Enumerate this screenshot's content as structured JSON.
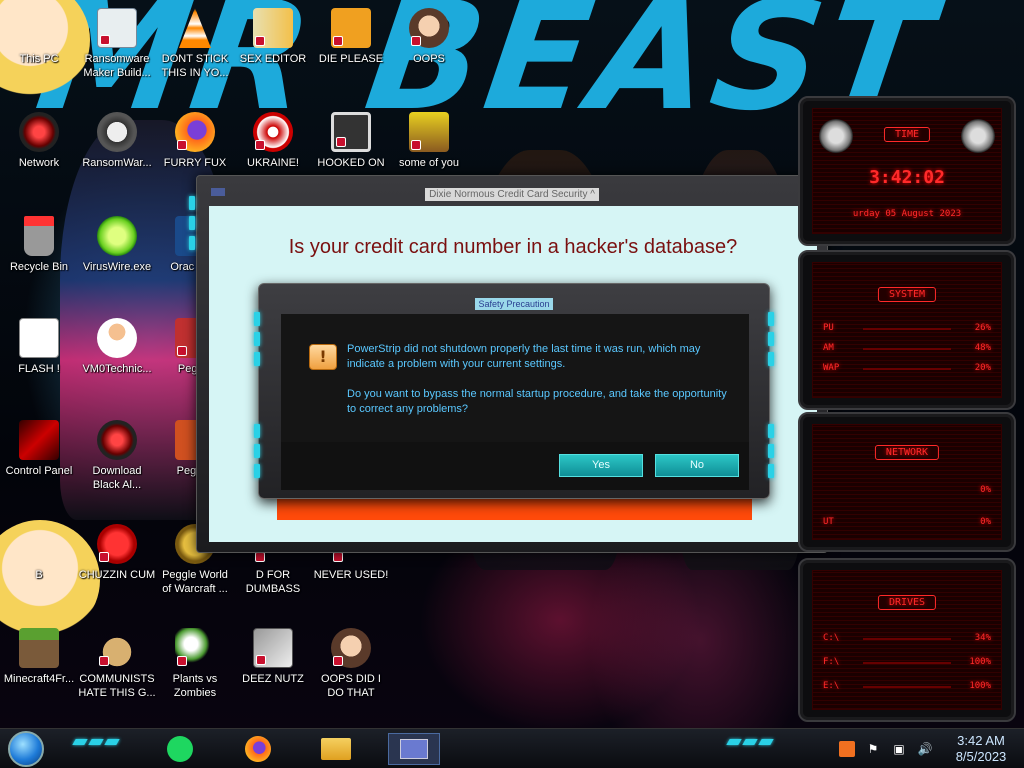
{
  "wallpaper": {
    "text": "MR BEAST"
  },
  "desktop_icons": [
    {
      "label": "This PC"
    },
    {
      "label": "Ransomware Maker Build..."
    },
    {
      "label": "DONT STICK THIS IN YO..."
    },
    {
      "label": "SEX EDITOR"
    },
    {
      "label": "DIE PLEASE"
    },
    {
      "label": "OOPS"
    },
    {
      "label": "Network"
    },
    {
      "label": "RansomWar..."
    },
    {
      "label": "FURRY FUX"
    },
    {
      "label": "UKRAINE!"
    },
    {
      "label": "HOOKED ON"
    },
    {
      "label": "some of you"
    },
    {
      "label": "Recycle Bin"
    },
    {
      "label": "VirusWire.exe"
    },
    {
      "label": "Orac Virtu"
    },
    {
      "label": "FLASH !"
    },
    {
      "label": "VM0Technic..."
    },
    {
      "label": "Peggle"
    },
    {
      "label": "Control Panel"
    },
    {
      "label": "Download Black Al..."
    },
    {
      "label": "Pegg D"
    },
    {
      "label": "B"
    },
    {
      "label": "CHUZZIN CUM"
    },
    {
      "label": "Peggle World of Warcraft ..."
    },
    {
      "label": "D FOR DUMBASS"
    },
    {
      "label": "NEVER USED!"
    },
    {
      "label": "Minecraft4Fr..."
    },
    {
      "label": "COMMUNISTS HATE THIS G..."
    },
    {
      "label": "Plants vs Zombies"
    },
    {
      "label": "DEEZ NUTZ"
    },
    {
      "label": "OOPS DID I DO THAT"
    }
  ],
  "main_window": {
    "title": "Dixie Normous Credit Card Security ^",
    "headline": "Is your credit card number in a hacker's database?"
  },
  "inner_dialog": {
    "title": "Safety Precaution",
    "message1": "PowerStrip did not shutdown properly the last time it was run, which may indicate a problem with your current settings.",
    "message2": "Do you want to bypass the normal startup procedure, and take the opportunity to correct any problems?",
    "yes_label": "Yes",
    "no_label": "No"
  },
  "widgets": {
    "time": {
      "title": "TIME",
      "clock": "3:42:02",
      "date": "urday 05 August 2023"
    },
    "system": {
      "title": "SYSTEM",
      "rows": [
        {
          "key": "PU",
          "value": "26%"
        },
        {
          "key": "AM",
          "value": "48%"
        },
        {
          "key": "WAP",
          "value": "20%"
        }
      ]
    },
    "network": {
      "title": "NETWORK",
      "rows": [
        {
          "key": "",
          "value": "0%"
        },
        {
          "key": "UT",
          "value": "0%"
        }
      ]
    },
    "drives": {
      "title": "DRIVES",
      "rows": [
        {
          "key": "C:\\",
          "value": "34%"
        },
        {
          "key": "F:\\",
          "value": "100%"
        },
        {
          "key": "E:\\",
          "value": "100%"
        }
      ]
    }
  },
  "taskbar": {
    "clock_time": "3:42 AM",
    "clock_date": "8/5/2023",
    "apps": [
      "spotify-icon",
      "firefox-icon",
      "file-explorer-icon",
      "active-window-icon"
    ]
  },
  "colors": {
    "accent_cyan": "#2ad1e6",
    "headline_red": "#7a1010",
    "message_blue": "#5ac8ff",
    "widget_red": "#ff2a2a",
    "orange_bar": "#ff4a0a"
  }
}
